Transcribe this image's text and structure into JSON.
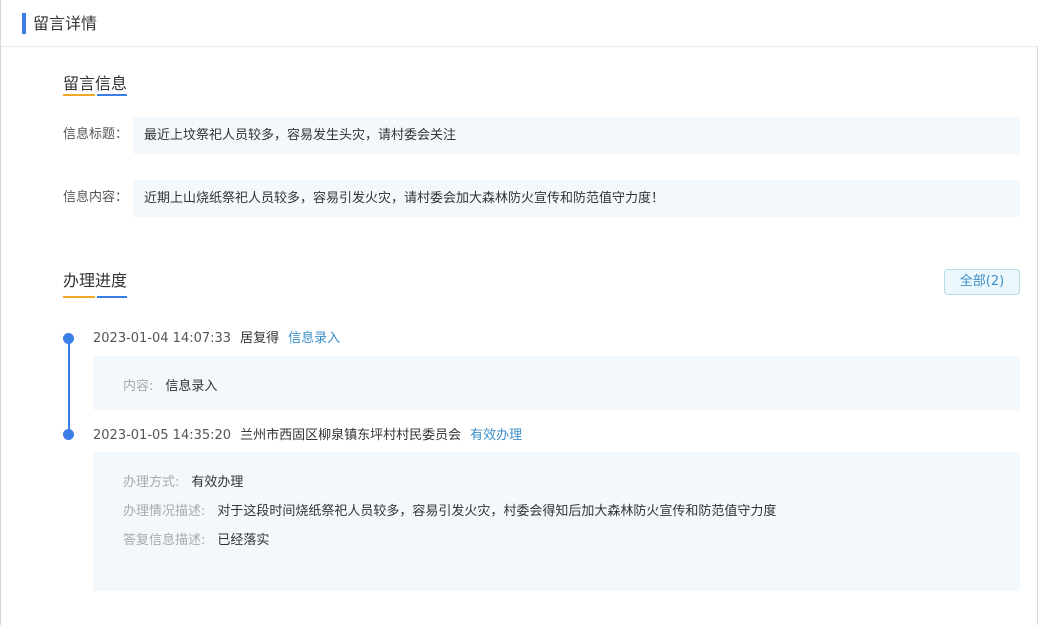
{
  "header": {
    "title": "留言详情"
  },
  "message_info": {
    "section_title": "留言信息",
    "title_label": "信息标题：",
    "title_value": "最近上坟祭祀人员较多，容易发生头灾，请村委会关注",
    "content_label": "信息内容：",
    "content_value": "近期上山烧纸祭祀人员较多，容易引发火灾，请村委会加大森林防火宣传和防范值守力度！"
  },
  "progress": {
    "section_title": "办理进度",
    "all_button": "全部(2)",
    "entries": [
      {
        "time": "2023-01-04 14:07:33",
        "person": "居复得",
        "status": "信息录入",
        "details": [
          {
            "key": "内容:",
            "value": "信息录入"
          }
        ]
      },
      {
        "time": "2023-01-05 14:35:20",
        "person": "兰州市西固区柳泉镇东坪村村民委员会",
        "status": "有效办理",
        "details": [
          {
            "key": "办理方式:",
            "value": "有效办理"
          },
          {
            "key": "办理情况描述:",
            "value": "对于这段时间烧纸祭祀人员较多，容易引发火灾，村委会得知后加大森林防火宣传和防范值守力度"
          },
          {
            "key": "答复信息描述:",
            "value": "已经落实"
          }
        ]
      }
    ]
  }
}
